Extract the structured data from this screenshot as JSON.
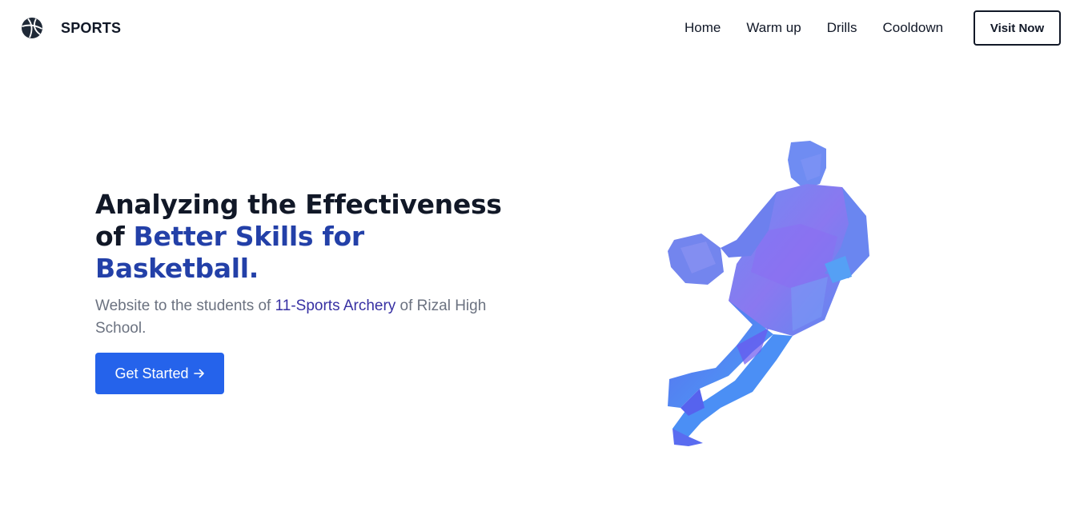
{
  "brand": {
    "name": "SPORTS",
    "logo_icon": "basketball-icon"
  },
  "nav": {
    "links": [
      {
        "label": "Home"
      },
      {
        "label": "Warm up"
      },
      {
        "label": "Drills"
      },
      {
        "label": "Cooldown"
      }
    ],
    "visit_label": "Visit Now"
  },
  "hero": {
    "title_line1": "Analyzing the Effectiveness",
    "title_of": "of ",
    "title_accent1": "Better Skills for",
    "title_accent2": "Basketball.",
    "subtitle_prefix": "Website to the students of ",
    "subtitle_highlight": "11-Sports Archery",
    "subtitle_suffix": " of Rizal High School.",
    "cta_label": "Get Started",
    "cta_icon": "arrow-right-icon",
    "image_icon": "basketball-player-illustration"
  },
  "colors": {
    "accent": "#2340a8",
    "button": "#2563eb",
    "text": "#111827",
    "muted": "#6b7280"
  }
}
